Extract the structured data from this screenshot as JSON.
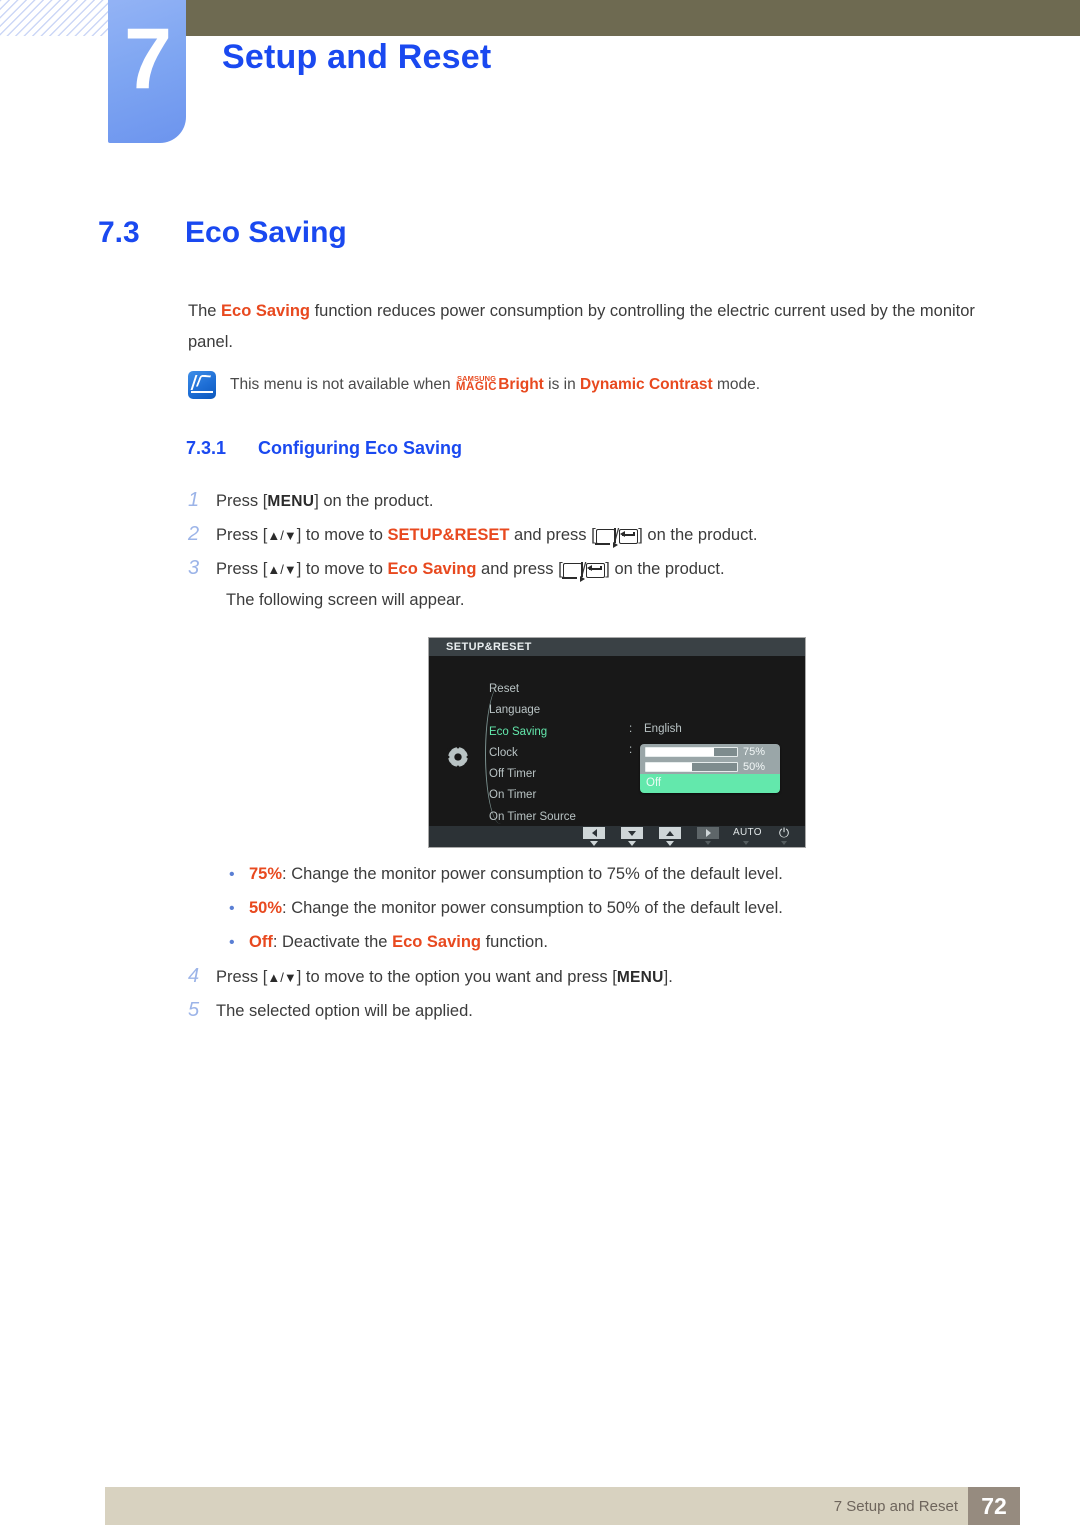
{
  "chapter": {
    "number": "7",
    "title": "Setup and Reset"
  },
  "section": {
    "number": "7.3",
    "title": "Eco Saving",
    "intro_before": "The ",
    "intro_keyword": "Eco Saving",
    "intro_after": " function reduces power consumption by controlling the electric current used by the monitor panel."
  },
  "note": {
    "text_before": "This menu is not available when ",
    "magic_super": "SAMSUNG",
    "magic_main": "MAGIC",
    "bright": "Bright",
    "text_mid": " is in ",
    "mode": "Dynamic Contrast",
    "text_after": " mode.",
    "icon": "note-pencil-icon"
  },
  "subsection": {
    "number": "7.3.1",
    "title": "Configuring Eco Saving"
  },
  "steps": {
    "s1": {
      "num": "1",
      "pre": "Press [",
      "key": "MENU",
      "post": "] on the product."
    },
    "s2": {
      "num": "2",
      "pre": "Press [",
      "arrows": "▲/▼",
      "mid": "] to move to ",
      "target": "SETUP&RESET",
      "mid2": " and press [",
      "sep": "/",
      "post": "] on the product."
    },
    "s3": {
      "num": "3",
      "pre": "Press [",
      "arrows": "▲/▼",
      "mid": "] to move to ",
      "target": "Eco Saving",
      "mid2": " and press [",
      "sep": "/",
      "post": "] on the product."
    },
    "s3_note": "The following screen will appear.",
    "s4": {
      "num": "4",
      "pre": "Press [",
      "arrows": "▲/▼",
      "mid": "] to move to the option you want and press [",
      "key": "MENU",
      "post": "]."
    },
    "s5": {
      "num": "5",
      "text": "The selected option will be applied."
    }
  },
  "bullets": [
    {
      "marker": "•",
      "label": "75%",
      "text": ": Change the monitor power consumption to 75% of the default level."
    },
    {
      "marker": "•",
      "label": "50%",
      "text": ": Change the monitor power consumption to 50% of the default level."
    },
    {
      "marker": "•",
      "label": "Off",
      "text_pre": ": Deactivate the ",
      "keyword": "Eco Saving",
      "text_post": " function."
    }
  ],
  "osd": {
    "title": "SETUP&RESET",
    "gear_icon": "gear-icon",
    "menu_items": [
      {
        "label": "Reset",
        "selected": false
      },
      {
        "label": "Language",
        "selected": false
      },
      {
        "label": "Eco Saving",
        "selected": true
      },
      {
        "label": "Clock",
        "selected": false
      },
      {
        "label": "Off Timer",
        "selected": false
      },
      {
        "label": "On Timer",
        "selected": false
      },
      {
        "label": "On Timer Source",
        "selected": false
      }
    ],
    "scroll_caret": "caret-down-icon",
    "colon1": ":",
    "colon2": ":",
    "language_value": "English",
    "popup": {
      "rows": [
        {
          "label": "75%",
          "fill_percent": 75
        },
        {
          "label": "50%",
          "fill_percent": 50
        }
      ],
      "off_label": "Off",
      "off_highlight_color": "#63e8ac"
    },
    "footer_keys": [
      {
        "name": "left-button",
        "glyph": "◀",
        "type": "tri-l",
        "dim": false
      },
      {
        "name": "down-button",
        "glyph": "▼",
        "type": "tri-d",
        "dim": false
      },
      {
        "name": "up-button",
        "glyph": "▲",
        "type": "tri-u",
        "dim": false
      },
      {
        "name": "right-button",
        "glyph": "▶",
        "type": "tri-r",
        "dim": true
      },
      {
        "name": "auto-button",
        "glyph": "AUTO",
        "type": "text",
        "dim": true
      },
      {
        "name": "power-button",
        "glyph": "⏻",
        "type": "power",
        "dim": true
      }
    ]
  },
  "footer": {
    "chapter_label": "7 Setup and Reset",
    "page_number": "72"
  },
  "colors": {
    "accent_blue": "#1a49f0",
    "accent_orange": "#e8491f",
    "olive": "#6e6a51",
    "tab_blue": "#7fa6f2",
    "footer_bg": "#d8d2c0",
    "page_box": "#968b7f",
    "osd_select_green": "#63e8ac"
  }
}
